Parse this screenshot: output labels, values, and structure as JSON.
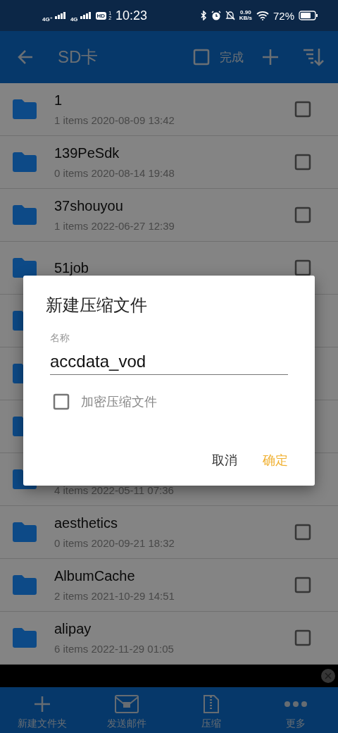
{
  "status_bar": {
    "sim1_network": "4G⁺",
    "sim2_network": "4G",
    "hd_badge": "HD",
    "sim_numbers": [
      "1",
      "2"
    ],
    "time": "10:23",
    "net_speed_value": "0.90",
    "net_speed_unit": "KB/s",
    "battery": "72%"
  },
  "toolbar": {
    "title": "SD卡",
    "select_all_checked": false,
    "done": "完成"
  },
  "files": [
    {
      "kind": "folder",
      "name": "1",
      "details": "1 items 2020-08-09 13:42",
      "checked": false
    },
    {
      "kind": "folder",
      "name": "139PeSdk",
      "details": "0 items 2020-08-14 19:48",
      "checked": false
    },
    {
      "kind": "folder",
      "name": "37shouyou",
      "details": "1 items 2022-06-27 12:39",
      "checked": false
    },
    {
      "kind": "folder",
      "name": "51job",
      "checked": false
    },
    {
      "kind": "folder"
    },
    {
      "kind": "folder"
    },
    {
      "kind": "folder"
    },
    {
      "kind": "folder",
      "details": "4 items 2022-05-11 07:36"
    },
    {
      "kind": "folder",
      "name": "aesthetics",
      "details": "0 items 2020-09-21 18:32",
      "checked": false
    },
    {
      "kind": "folder",
      "name": "AlbumCache",
      "details": "2 items 2021-10-29 14:51",
      "checked": false
    },
    {
      "kind": "folder",
      "name": "alipay",
      "details": "6 items 2022-11-29 01:05",
      "checked": false
    }
  ],
  "bottom_nav": [
    {
      "kind": "add",
      "label": "新建文件夹"
    },
    {
      "kind": "mail",
      "label": "发送邮件"
    },
    {
      "kind": "zip",
      "label": "压缩"
    },
    {
      "kind": "more",
      "label": "更多"
    }
  ],
  "dialog": {
    "title": "新建压缩文件",
    "field_label": "名称",
    "value": "accdata_vod",
    "encrypt": {
      "label": "加密压缩文件",
      "checked": false
    },
    "buttons": [
      {
        "kind": "cancel",
        "label": "取消"
      },
      {
        "kind": "ok",
        "label": "确定"
      }
    ]
  }
}
